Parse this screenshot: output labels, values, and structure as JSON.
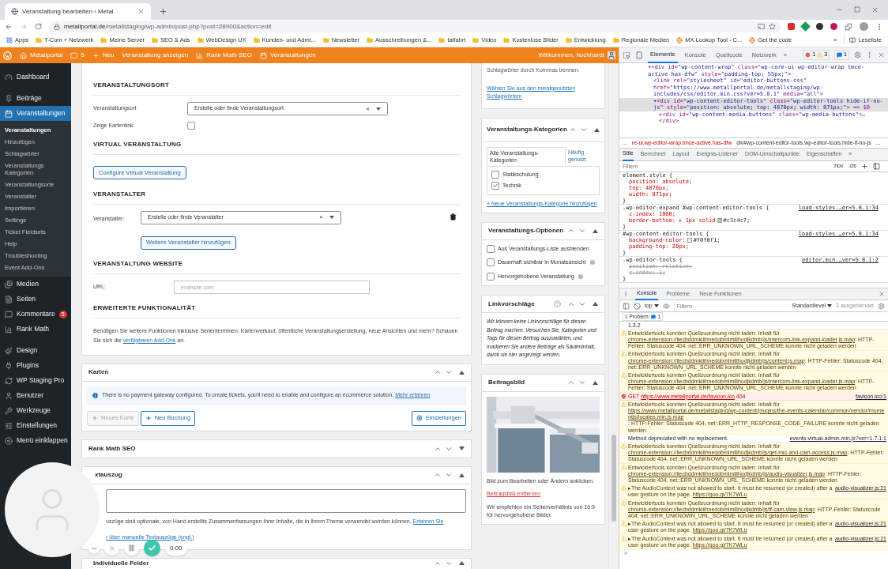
{
  "browser": {
    "tab": {
      "title": "Veranstaltung bearbeiten ‹ Metal"
    },
    "url": {
      "host": "metallportal.de",
      "path": "/metallstaging/wp-admin/post.php?post=28900&action=edit"
    },
    "bookmarks": [
      {
        "kind": "apps",
        "label": "Apps"
      },
      {
        "kind": "folder",
        "label": "T-Com + Netzwerk"
      },
      {
        "kind": "folder",
        "label": "Meine Server"
      },
      {
        "kind": "folder",
        "label": "SEO & Ads"
      },
      {
        "kind": "folder",
        "label": "WebDesign UX"
      },
      {
        "kind": "folder",
        "label": "Kunden- und Admi..."
      },
      {
        "kind": "folder",
        "label": "Newsletter"
      },
      {
        "kind": "folder",
        "label": "Ausschreibungen &..."
      },
      {
        "kind": "folder",
        "label": "talfahrt"
      },
      {
        "kind": "folder",
        "label": "Video"
      },
      {
        "kind": "folder",
        "label": "Kostenlose Bilder"
      },
      {
        "kind": "folder",
        "label": "Entwicklung"
      },
      {
        "kind": "folder",
        "label": "Regionale Medien"
      },
      {
        "kind": "site",
        "label": "MX Lookup Tool - C..."
      },
      {
        "kind": "site",
        "label": "Get the code"
      }
    ],
    "bookmarks_more": "»",
    "reading_list": "Leseliste"
  },
  "admin_bar": {
    "items": [
      "Metallportal",
      "5",
      "Neu",
      "Veranstaltung anzeigen",
      "Rank Math SEO",
      "Veranstaltungen"
    ],
    "greeting": "Willkommen, hochhardt"
  },
  "sidebar": {
    "groups": [
      [
        {
          "label": "Dashboard",
          "selected": false
        }
      ],
      [
        {
          "label": "Beiträge",
          "selected": false
        },
        {
          "label": "Veranstaltungen",
          "selected": true,
          "children": [
            {
              "label": "Veranstaltungen",
              "selected": true
            },
            {
              "label": "Hinzufügen",
              "selected": false
            },
            {
              "label": "Schlagwörter",
              "selected": false
            },
            {
              "label": "Veranstaltungs Kategorien",
              "selected": false
            },
            {
              "label": "Veranstaltungsorte",
              "selected": false
            },
            {
              "label": "Veranstalter",
              "selected": false
            },
            {
              "label": "Importieren",
              "selected": false
            },
            {
              "label": "Settings",
              "selected": false
            },
            {
              "label": "Ticket Fieldsets",
              "selected": false
            },
            {
              "label": "Help",
              "selected": false
            },
            {
              "label": "Troubleshooting",
              "selected": false
            },
            {
              "label": "Event Add-Ons",
              "selected": false
            }
          ]
        },
        {
          "label": "Medien",
          "selected": false
        },
        {
          "label": "Seiten",
          "selected": false
        },
        {
          "label": "Kommentare",
          "selected": false,
          "badge": "5"
        },
        {
          "label": "Rank Math",
          "selected": false
        }
      ],
      [
        {
          "label": "Design",
          "selected": false
        },
        {
          "label": "Plugins",
          "selected": false
        },
        {
          "label": "WP Staging Pro",
          "selected": false
        },
        {
          "label": "Benutzer",
          "selected": false
        },
        {
          "label": "Werkzeuge",
          "selected": false
        },
        {
          "label": "Einstellungen",
          "selected": false
        },
        {
          "label": "Menü einklappen",
          "selected": false
        }
      ]
    ]
  },
  "event_details": {
    "venue": {
      "heading": "VERANSTALTUNGSORT",
      "label": "Veranstaltungsort",
      "value": "Erstelle oder finde Veranstaltungsort",
      "clear": "×",
      "map_label": "Zeige Kartenlink",
      "map_checked": false
    },
    "virtual": {
      "heading": "VIRTUAL VERANSTALTUNG",
      "button": "Configure Virtual Veranstaltung"
    },
    "organizer": {
      "heading": "VERANSTALTER",
      "label": "Veranstalter:",
      "value": "Erstelle oder finde Veranstalter",
      "clear": "×",
      "add_button": "Weitere Veranstalter hinzufügen"
    },
    "website": {
      "heading": "VERANSTALTUNG WEBSITE",
      "label": "URL:",
      "placeholder": "example.com"
    },
    "extended": {
      "heading": "ERWEITERTE FUNKTIONALITÄT",
      "text": "Benötigen Sie weitere Funktionen inklusive Serienterminen, Kartenverkauf, öffentliche Veranstaltungserstellung, neue Ansichten und mehr? Schauen Sie sich die ",
      "link": "verfügbaren Add-Ons",
      "text_after": " an."
    }
  },
  "tickets": {
    "title": "Karten",
    "expanded": true,
    "notice": "There is no payment gateway configured. To create tickets, you'll need to enable and configure an ecommerce solution. ",
    "notice_link": "Mehr erfahren",
    "buttons": [
      {
        "label": "Neues Karte",
        "disabled": true
      },
      {
        "label": "Neu Buchung",
        "disabled": false
      }
    ],
    "settings": "Einstellungen"
  },
  "rank_math": {
    "title": "Rank Math SEO",
    "expanded": false
  },
  "excerpt": {
    "title": "xtauszug",
    "expanded": true,
    "help": "uszüge sind optionale, von Hand erstellte Zusammenfassungen Ihrer Inhalte, die in Ihrem Theme verwendet werden können. ",
    "help_link": "Erfahren Sie",
    "help_line2": "r über manuelle Textauszüge (engl.)"
  },
  "custom_fields": {
    "title": "Individuelle Felder",
    "expanded": true
  },
  "tags_box": {
    "text": "Schlagwörter durch Kommas trennen.",
    "link": "Wählen Sie aus den meistgenutzten Schlagwörtern"
  },
  "categories": {
    "title": "Veranstaltungs-Kategorien",
    "expanded": true,
    "tabs": [
      {
        "label": "Alle Veranstaltungs-Kategorien",
        "selected": true
      },
      {
        "label": "Häufig genutzt",
        "selected": false
      }
    ],
    "items": [
      {
        "label": "Statikschulung",
        "checked": false
      },
      {
        "label": "Technik",
        "checked": true
      }
    ],
    "add_link": "+ Neue Veranstaltungs-Kategorie hinzufügen"
  },
  "options": {
    "title": "Veranstaltungs-Optionen",
    "expanded": true,
    "items": [
      {
        "label": "Aus Veranstaltungs-Liste ausblenden",
        "checked": false,
        "help": false
      },
      {
        "label": "Dauerhaft sichtbar in Monatsansicht",
        "checked": false,
        "help": true
      },
      {
        "label": "Hervorgehobene Veranstaltung",
        "checked": false,
        "help": true
      }
    ]
  },
  "link_suggestions": {
    "title": "Linkvorschläge",
    "expanded": true,
    "text": "Wir können keine Linkvorschläge für diesen Beitrag machen. Versuchen Sie, Kategorien und Tags für diesen Beitrag auszuwählen, und markieren Sie andere Beiträge als Säuleninhalt, damit sie hier angezeigt werden."
  },
  "featured_image": {
    "title": "Beitragsbild",
    "expanded": true,
    "hint": "Bild zum Bearbeiten oder Ändern anklicken.",
    "remove": "Beitragsbild entfernen",
    "note": "Wir empfehlen ein Seitenverhältnis von 16:9 für hervorgehobene Bilder."
  },
  "recorder": {
    "time": "0:00"
  },
  "devtools": {
    "tabs": [
      {
        "label": "Elemente",
        "selected": true
      },
      {
        "label": "Konsole",
        "selected": false
      },
      {
        "label": "Quellcode",
        "selected": false
      },
      {
        "label": "Netzwerk",
        "selected": false
      }
    ],
    "tabs_more": "»",
    "errors": "1",
    "warnings": "3",
    "issues": "1",
    "dom": [
      {
        "text": "▾<div id=\"wp-content-wrap\" class=\"wp-core-ui wp-editor-wrap tmce-active has-dfw\" style=\"padding-top: 55px;\">",
        "selected": false,
        "children": [
          {
            "text": "<link rel=\"stylesheet\" id=\"editor-buttons-css\" href=\"https://www.metallportal.de/metallstaging/wp-includes/css/editor.min.css?ver=5.8.1\" media=\"all\">",
            "selected": false
          },
          {
            "text": "▾<div id=\"wp-content-editor-tools\" class=\"wp-editor-tools hide-if-no-js\" style=\"position: absolute; top: 4870px; width: 871px;\"> == $0",
            "selected": true,
            "children": [
              {
                "text": "▸<div id=\"wp-content-media-buttons\" class=\"wp-media-buttons\">…",
                "selected": false
              },
              {
                "text": "</div>",
                "selected": false
              }
            ]
          }
        ]
      }
    ],
    "breadcrumb": [
      "...",
      "re-ui.wp-editor-wrap.tmce-active.has-dfw",
      "div#wp-content-editor-tools.wp-editor-tools.hide-if-no-js",
      "..."
    ],
    "subtabs": [
      {
        "label": "Stile",
        "selected": true
      },
      {
        "label": "Berechnet",
        "selected": false
      },
      {
        "label": "Layout",
        "selected": false
      },
      {
        "label": "Ereignis-Listener",
        "selected": false
      },
      {
        "label": "DOM-Umschaltpunkte",
        "selected": false
      },
      {
        "label": "Eigenschaften",
        "selected": false
      }
    ],
    "subtabs_more": "»",
    "filter": {
      "placeholder": "Filtern",
      "hov": ":hov",
      "cls": ".cls"
    },
    "rules": [
      {
        "selector": "element.style {",
        "props": [
          {
            "text": "position: absolute;",
            "struck": false
          },
          {
            "text": "top: 4870px;",
            "struck": false
          },
          {
            "text": "width: 871px;",
            "struck": false
          }
        ],
        "close": "}"
      },
      {
        "selector": ".wp-editor-expand #wp-content-editor-tools {",
        "source": "load-styles.…er=5.8.1:34",
        "props": [
          {
            "text": "z-index: 1000;",
            "struck": false
          },
          {
            "text": "border-bottom: ▸ 1px solid",
            "swatch": "#c3c4c7",
            "after": ";",
            "struck": false
          }
        ],
        "close": "}"
      },
      {
        "selector": "#wp-content-editor-tools {",
        "source": "load-styles.…er=5.8.1:34",
        "props": [
          {
            "text": "background-color:",
            "swatch": "#f0f0f1",
            "after": ";",
            "struck": false
          },
          {
            "text": "padding-top: 20px;",
            "struck": false
          }
        ],
        "close": "}"
      },
      {
        "selector": ".wp-editor-tools {",
        "source": "editor.min.…ver=5.8.1:2",
        "props": [
          {
            "text": "position: relative;",
            "struck": true
          },
          {
            "text": "z-index: 1;",
            "struck": true
          }
        ],
        "close": "}"
      }
    ],
    "drawer_tabs": [
      {
        "label": "Konsole",
        "selected": true
      },
      {
        "label": "Probleme",
        "selected": false
      },
      {
        "label": "Neue Funktionen",
        "selected": false
      }
    ],
    "console": {
      "context": "top",
      "filter_placeholder": "Filtern",
      "level": "Standardlevel",
      "hidden": "3 ausgeblendet",
      "problems": "1 Problem:",
      "problems_count": "1",
      "messages": [
        {
          "kind": "log",
          "text": "1.3.2"
        },
        {
          "kind": "warning",
          "text": "Entwicklertools konnten Quellzuordnung nicht laden: Inhalt für ",
          "link": "chrome-extension://liecbddmkiiihnedobmlmillhodjkdmb/js/intercom-link-expand-loader.js.map",
          "after": ": HTTP-Fehler: Statuscode 404, net::ERR_UNKNOWN_URL_SCHEME konnte nicht geladen werden"
        },
        {
          "kind": "warning",
          "text": "Entwicklertools konnten Quellzuordnung nicht laden: Inhalt für ",
          "link": "chrome-extension://liecbddmkiiihnedobmlmillhodjkdmb/js/content.js.map",
          "after": ": HTTP-Fehler: Statuscode 404, net::ERR_UNKNOWN_URL_SCHEME konnte nicht geladen werden"
        },
        {
          "kind": "warning",
          "text": "Entwicklertools konnten Quellzuordnung nicht laden: Inhalt für ",
          "link": "chrome-extension://liecbddmkiiihnedobmlmillhodjkdmb/js/intercom-link-expand-loader.js.map",
          "after": ": HTTP-Fehler: Statuscode 404, net::ERR_UNKNOWN_URL_SCHEME konnte nicht geladen werden"
        },
        {
          "kind": "error",
          "text": "GET ",
          "link": "https://www.metallportal.de/favicon.ico",
          "after": " 404",
          "source": "favicon.ico:1"
        },
        {
          "kind": "warning",
          "text": "Entwicklertools konnten Quellzuordnung nicht laden: Inhalt für ",
          "link": "https://www.metallportal.de/metallstaging/wp-content/plugins/the-events-calendar/common/vendor/momentjs/locales.min.js.map",
          "after": ": HTTP-Fehler: Statuscode 404, net::ERR_HTTP_RESPONSE_CODE_FAILURE konnte nicht geladen werden"
        },
        {
          "kind": "log",
          "text": "Method deprecated with no replacement.",
          "source": "events-virtual-admin.min.js?ver=1.7.1:1"
        },
        {
          "kind": "warning",
          "text": "Entwicklertools konnten Quellzuordnung nicht laden: Inhalt für ",
          "link": "chrome-extension://liecbddmkiiihnedobmlmillhodjkdmb/js/get-mic-and-cam-access.js.map",
          "after": ": HTTP-Fehler: Statuscode 404, net::ERR_UNKNOWN_URL_SCHEME konnte nicht geladen werden"
        },
        {
          "kind": "warning",
          "text": "Entwicklertools konnten Quellzuordnung nicht laden: Inhalt für ",
          "link": "chrome-extension://liecbddmkiiihnedobmlmillhodjkdmb/js/audio-visualizer.js.map",
          "after": ": HTTP-Fehler: Statuscode 404, net::ERR_UNKNOWN_URL_SCHEME konnte nicht geladen werden"
        },
        {
          "kind": "warning",
          "text": "▸The AudioContext was not allowed to start. It must be resumed (or created) after a user gesture on the page. ",
          "link": "https://goo.gl/7K7WLu",
          "source": "audio-visualizer.js:21"
        },
        {
          "kind": "warning",
          "text": "Entwicklertools konnten Quellzuordnung nicht laden: Inhalt für ",
          "link": "chrome-extension://liecbddmkiiihnedobmlmillhodjkdmb/js/ff-cam-view.js.map",
          "after": ": HTTP-Fehler: Statuscode 404, net::ERR_UNKNOWN_URL_SCHEME konnte nicht geladen werden"
        },
        {
          "kind": "warning",
          "text": "▸The AudioContext was not allowed to start. It must be resumed (or created) after a user gesture on the page. ",
          "link": "https://goo.gl/7K7WLu",
          "source": "audio-visualizer.js:21"
        },
        {
          "kind": "warning",
          "text": "▸The AudioContext was not allowed to start. It must be resumed (or created) after a user gesture on the page. ",
          "link": "https://goo.gl/7K7WLu",
          "source": "audio-visualizer.js:21"
        }
      ],
      "prompt": ">"
    }
  }
}
